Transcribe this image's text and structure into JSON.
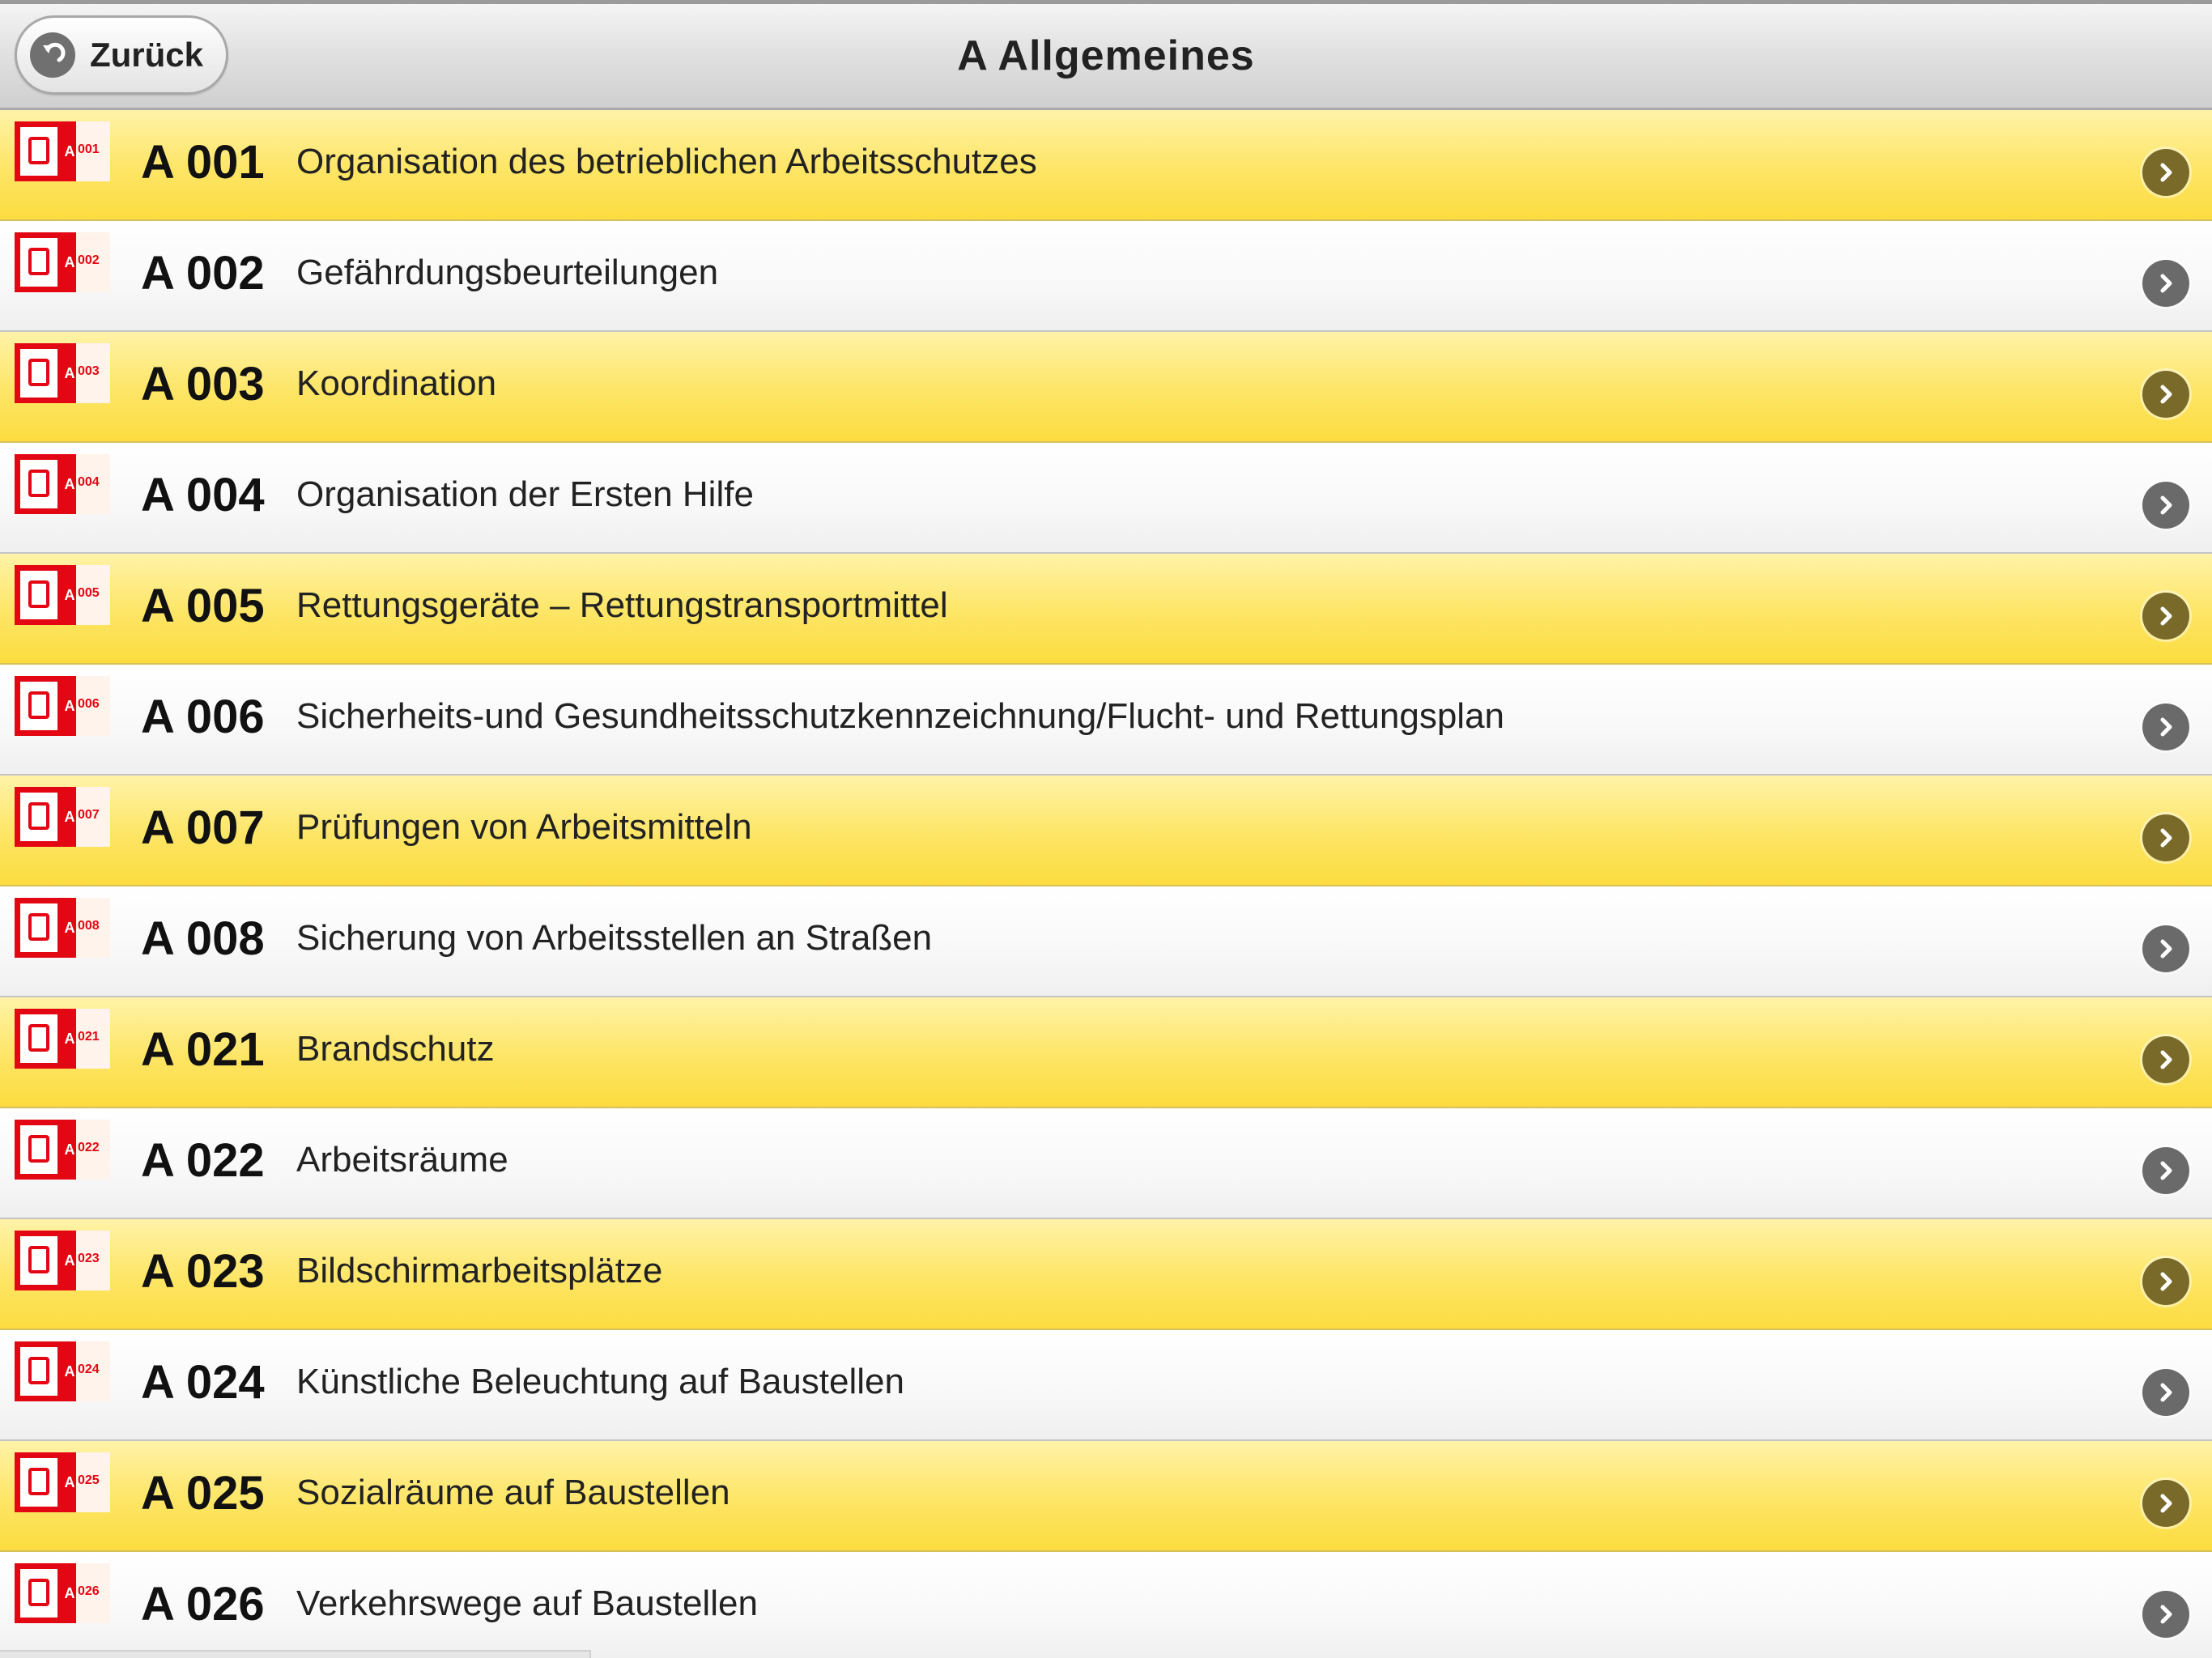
{
  "header": {
    "back_label": "Zurück",
    "title": "A  Allgemeines"
  },
  "items": [
    {
      "code": "A 001",
      "label": "Organisation des betrieblichen Arbeitsschutzes",
      "tag": "001",
      "color": "yellow"
    },
    {
      "code": "A 002",
      "label": "Gefährdungsbeurteilungen",
      "tag": "002",
      "color": "white"
    },
    {
      "code": "A 003",
      "label": "Koordination",
      "tag": "003",
      "color": "yellow"
    },
    {
      "code": "A 004",
      "label": "Organisation der Ersten Hilfe",
      "tag": "004",
      "color": "white"
    },
    {
      "code": "A 005",
      "label": "Rettungsgeräte – Rettungstransportmittel",
      "tag": "005",
      "color": "yellow"
    },
    {
      "code": "A 006",
      "label": "Sicherheits-und Gesundheitsschutzkennzeichnung/Flucht- und Rettungsplan",
      "tag": "006",
      "color": "white"
    },
    {
      "code": "A 007",
      "label": "Prüfungen von Arbeitsmitteln",
      "tag": "007",
      "color": "yellow"
    },
    {
      "code": "A 008",
      "label": "Sicherung von Arbeitsstellen an Straßen",
      "tag": "008",
      "color": "white"
    },
    {
      "code": "A 021",
      "label": "Brandschutz",
      "tag": "021",
      "color": "yellow"
    },
    {
      "code": "A 022",
      "label": "Arbeitsräume",
      "tag": "022",
      "color": "white"
    },
    {
      "code": "A 023",
      "label": "Bildschirmarbeitsplätze",
      "tag": "023",
      "color": "yellow"
    },
    {
      "code": "A 024",
      "label": "Künstliche Beleuchtung auf Baustellen",
      "tag": "024",
      "color": "white"
    },
    {
      "code": "A 025",
      "label": "Sozialräume auf Baustellen",
      "tag": "025",
      "color": "yellow"
    },
    {
      "code": "A 026",
      "label": "Verkehrswege auf Baustellen",
      "tag": "026",
      "color": "white"
    }
  ],
  "icons": {
    "back": "back-arrow-icon",
    "row_arrow": "chevron-right-icon",
    "row_pictogram": "safety-pictogram-icon"
  },
  "colors": {
    "accent_red": "#e30613",
    "row_yellow": "#fde565",
    "row_white": "#f8f8f8"
  }
}
